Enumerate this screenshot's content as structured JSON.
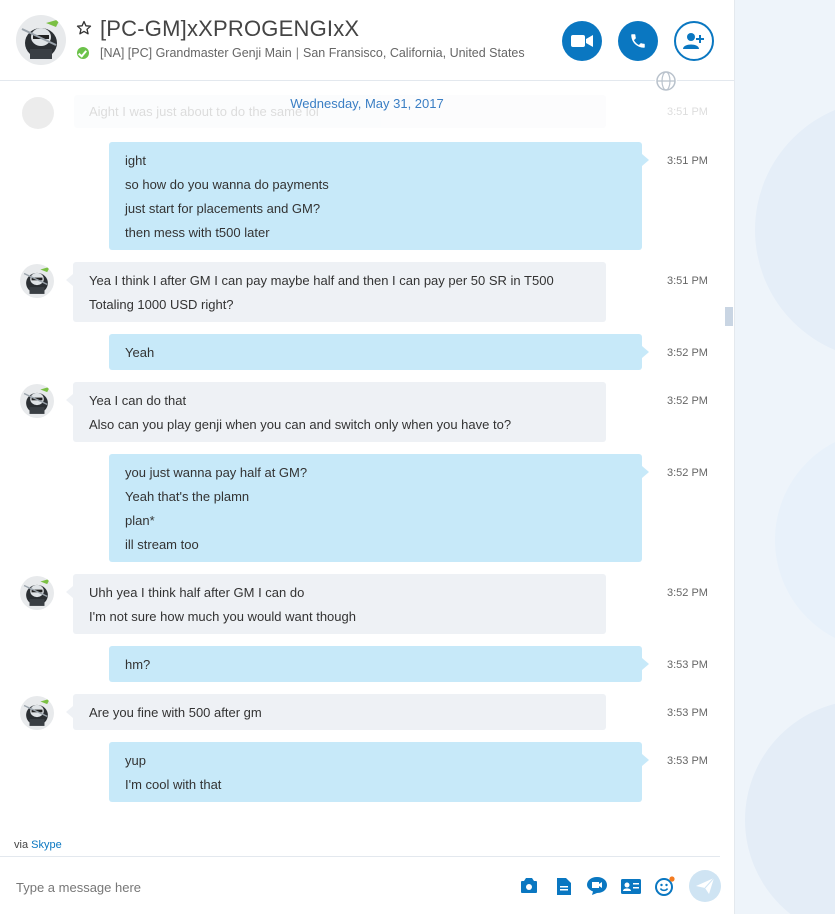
{
  "header": {
    "contact_name": "[PC-GM]xXPROGENGIxX",
    "mood_1": "[NA] [PC] Grandmaster Genji Main",
    "mood_sep": "|",
    "mood_2": "San Fransisco, California, United States",
    "status": "online",
    "buttons": {
      "video": "video-call",
      "audio": "audio-call",
      "add": "add-people"
    }
  },
  "date_separator": "Wednesday, May 31, 2017",
  "faded_message": {
    "text": "Aight I was just about to do the same lol",
    "time": "3:51 PM"
  },
  "messages": [
    {
      "dir": "out",
      "time": "3:51 PM",
      "lines": [
        "ight",
        "so how do you wanna do payments",
        "just start for placements and GM?",
        "then mess with t500 later"
      ]
    },
    {
      "dir": "in",
      "time": "3:51 PM",
      "lines": [
        "Yea I think I after GM I can pay maybe half and then I can pay per 50 SR in T500",
        "Totaling 1000 USD right?"
      ]
    },
    {
      "dir": "out",
      "time": "3:52 PM",
      "lines": [
        "Yeah"
      ]
    },
    {
      "dir": "in",
      "time": "3:52 PM",
      "lines": [
        "Yea I can do that",
        "Also can you play genji when you can and switch only when you have to?"
      ]
    },
    {
      "dir": "out",
      "time": "3:52 PM",
      "lines": [
        "you just wanna pay half at GM?",
        "Yeah that's the plamn",
        "plan*",
        "ill stream too"
      ]
    },
    {
      "dir": "in",
      "time": "3:52 PM",
      "lines": [
        "Uhh yea I think half after GM I can do",
        "I'm not sure how much you would want though"
      ]
    },
    {
      "dir": "out",
      "time": "3:53 PM",
      "lines": [
        "hm?"
      ]
    },
    {
      "dir": "in",
      "time": "3:53 PM",
      "lines": [
        "Are you fine with 500 after gm"
      ]
    },
    {
      "dir": "out",
      "time": "3:53 PM",
      "lines": [
        "yup",
        "I'm cool with that"
      ]
    }
  ],
  "footer": {
    "via_prefix": "via",
    "via_link": "Skype",
    "placeholder": "Type a message here"
  },
  "colors": {
    "accent": "#0a77c1",
    "outgoing_bubble": "#c7e9f9",
    "incoming_bubble": "#eef1f5",
    "online": "#6cc24a"
  }
}
